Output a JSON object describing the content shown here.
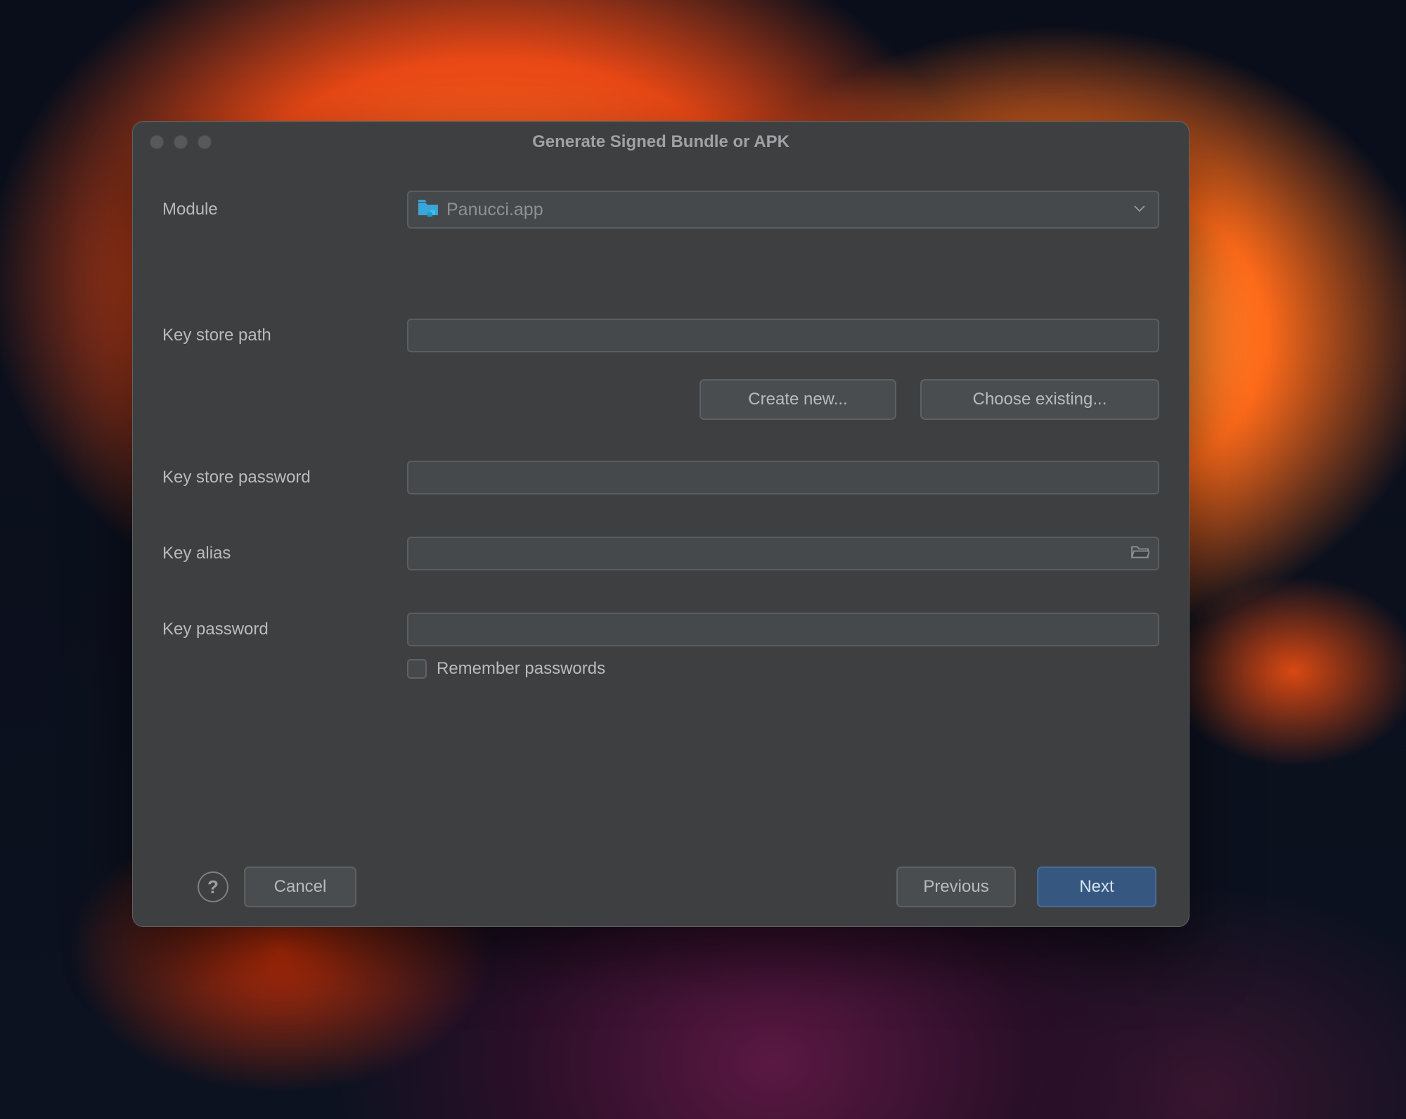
{
  "window": {
    "title": "Generate Signed Bundle or APK"
  },
  "form": {
    "module_label": "Module",
    "module_value": "Panucci.app",
    "keystore_path_label": "Key store path",
    "keystore_path_value": "",
    "create_new_label": "Create new...",
    "choose_existing_label": "Choose existing...",
    "keystore_password_label": "Key store password",
    "keystore_password_value": "",
    "key_alias_label": "Key alias",
    "key_alias_value": "",
    "key_password_label": "Key password",
    "key_password_value": "",
    "remember_passwords_label": "Remember passwords",
    "remember_passwords_checked": false
  },
  "footer": {
    "help_label": "?",
    "cancel_label": "Cancel",
    "previous_label": "Previous",
    "next_label": "Next"
  },
  "colors": {
    "dialog_bg": "#3d3f41",
    "input_bg": "#46494b",
    "border": "#5b5e60",
    "primary": "#365880"
  }
}
